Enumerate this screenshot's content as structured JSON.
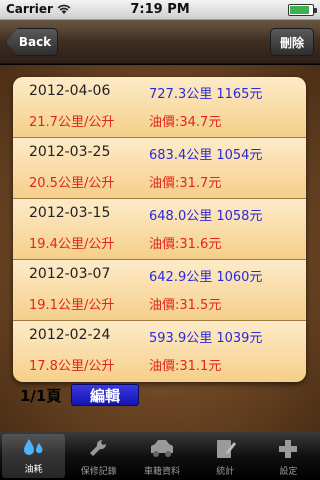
{
  "status_bar": {
    "carrier": "Carrier",
    "time": "7:19 PM",
    "battery_level": 0.85
  },
  "nav": {
    "back_label": "Back",
    "delete_label": "刪除"
  },
  "records": [
    {
      "date": "2012-04-06",
      "dist_cost": "727.3公里 1165元",
      "efficiency": "21.7公里/公升",
      "price": "油價:34.7元"
    },
    {
      "date": "2012-03-25",
      "dist_cost": "683.4公里 1054元",
      "efficiency": "20.5公里/公升",
      "price": "油價:31.7元"
    },
    {
      "date": "2012-03-15",
      "dist_cost": "648.0公里 1058元",
      "efficiency": "19.4公里/公升",
      "price": "油價:31.6元"
    },
    {
      "date": "2012-03-07",
      "dist_cost": "642.9公里 1060元",
      "efficiency": "19.1公里/公升",
      "price": "油價:31.5元"
    },
    {
      "date": "2012-02-24",
      "dist_cost": "593.9公里 1039元",
      "efficiency": "17.8公里/公升",
      "price": "油價:31.1元"
    }
  ],
  "pager": {
    "page_label": "1/1頁",
    "edit_label": "編輯"
  },
  "tabs": [
    {
      "label": "油耗",
      "icon": "fuel-drop-icon",
      "selected": true
    },
    {
      "label": "保修記錄",
      "icon": "wrench-icon",
      "selected": false
    },
    {
      "label": "車籍資料",
      "icon": "car-icon",
      "selected": false
    },
    {
      "label": "統計",
      "icon": "notepad-icon",
      "selected": false
    },
    {
      "label": "設定",
      "icon": "plus-icon",
      "selected": false
    }
  ],
  "colors": {
    "distance_blue": "#2a2adb",
    "efficiency_red": "#e0261a",
    "row_top": "#fdebc8",
    "row_bottom": "#f5cf8a",
    "edit_button": "#2020c8"
  }
}
